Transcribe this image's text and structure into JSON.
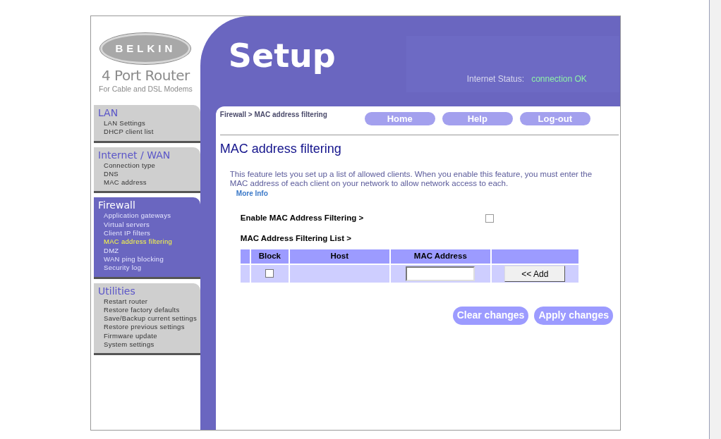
{
  "logo": {
    "brand": "BELKIN",
    "product": "4 Port Router",
    "subtitle": "For Cable and DSL Modems"
  },
  "header": {
    "title": "Setup",
    "status_label": "Internet Status:",
    "status_value": "connection OK"
  },
  "sidebar": {
    "sections": [
      {
        "title": "LAN",
        "selected": false,
        "items": [
          {
            "label": "LAN Settings",
            "selected": false
          },
          {
            "label": "DHCP client list",
            "selected": false
          }
        ]
      },
      {
        "title": "Internet / WAN",
        "selected": false,
        "items": [
          {
            "label": "Connection type",
            "selected": false
          },
          {
            "label": "DNS",
            "selected": false
          },
          {
            "label": "MAC address",
            "selected": false
          }
        ]
      },
      {
        "title": "Firewall",
        "selected": true,
        "items": [
          {
            "label": "Application gateways",
            "selected": false
          },
          {
            "label": "Virtual servers",
            "selected": false
          },
          {
            "label": "Client IP filters",
            "selected": false
          },
          {
            "label": "MAC address filtering",
            "selected": true
          },
          {
            "label": "DMZ",
            "selected": false
          },
          {
            "label": "WAN ping blocking",
            "selected": false
          },
          {
            "label": "Security log",
            "selected": false
          }
        ]
      },
      {
        "title": "Utilities",
        "selected": false,
        "items": [
          {
            "label": "Restart router",
            "selected": false
          },
          {
            "label": "Restore factory defaults",
            "selected": false
          },
          {
            "label": "Save/Backup current settings",
            "selected": false
          },
          {
            "label": "Restore previous settings",
            "selected": false
          },
          {
            "label": "Firmware update",
            "selected": false
          },
          {
            "label": "System settings",
            "selected": false
          }
        ]
      }
    ]
  },
  "breadcrumb": "Firewall > MAC address filtering",
  "nav_buttons": [
    "Home",
    "Help",
    "Log-out"
  ],
  "page_title": "MAC address filtering",
  "description": "This feature lets you set up a list of allowed clients. When you enable this feature, you must enter the MAC address of each client on your network to allow network access to each.",
  "more_info": "More Info",
  "enable": {
    "label": "Enable MAC Address Filtering >",
    "checked": false
  },
  "list_label": "MAC Address Filtering List >",
  "table": {
    "columns": [
      "Block",
      "Host",
      "MAC Address"
    ],
    "rows": [
      {
        "block": false,
        "add_button": "<< Add"
      }
    ]
  },
  "actions": [
    "Clear changes",
    "Apply changes"
  ]
}
